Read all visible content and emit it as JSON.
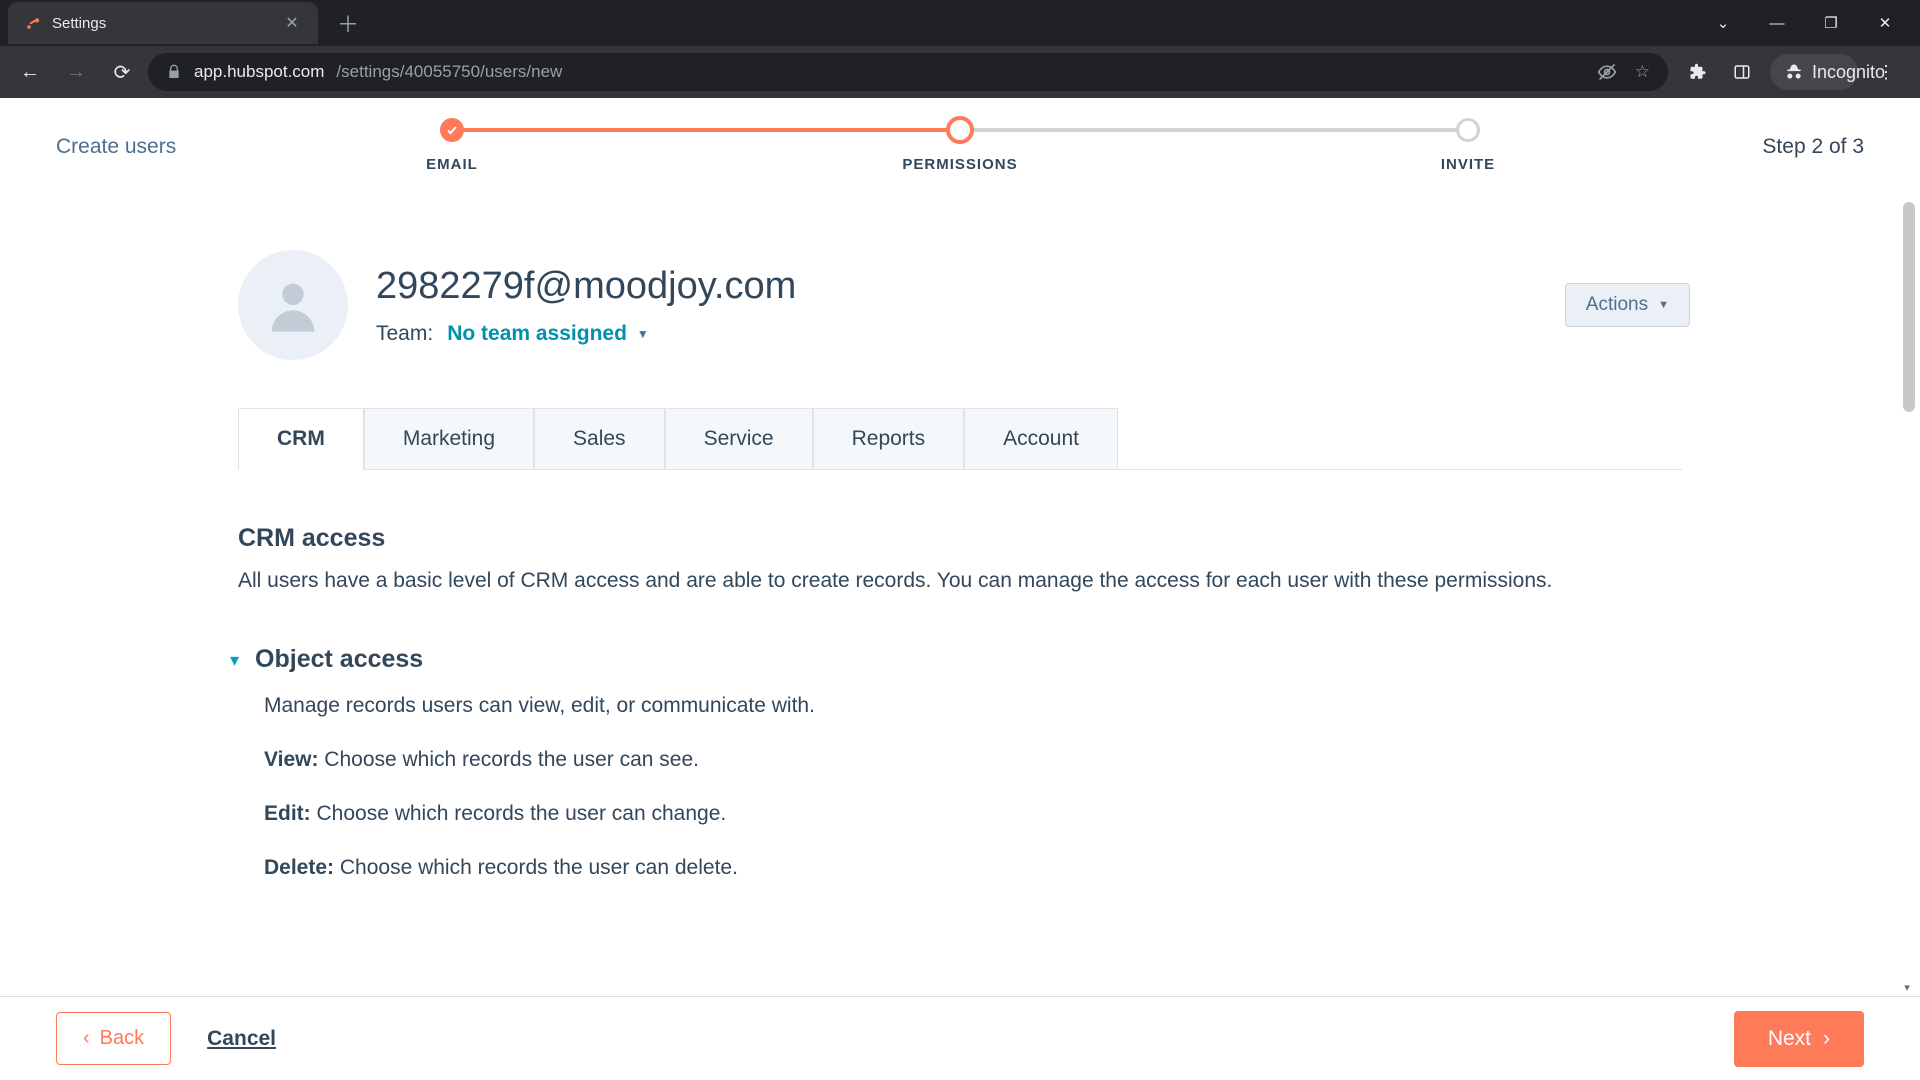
{
  "browser": {
    "tab_title": "Settings",
    "url_host": "app.hubspot.com",
    "url_path": "/settings/40055750/users/new",
    "incognito_label": "Incognito"
  },
  "header": {
    "create_users": "Create users",
    "step_text": "Step 2 of 3"
  },
  "stepper": {
    "steps": [
      {
        "label": "EMAIL"
      },
      {
        "label": "PERMISSIONS"
      },
      {
        "label": "INVITE"
      }
    ]
  },
  "user": {
    "email": "2982279f@moodjoy.com",
    "team_label": "Team:",
    "team_value": "No team assigned",
    "actions_label": "Actions"
  },
  "tabs": [
    {
      "label": "CRM"
    },
    {
      "label": "Marketing"
    },
    {
      "label": "Sales"
    },
    {
      "label": "Service"
    },
    {
      "label": "Reports"
    },
    {
      "label": "Account"
    }
  ],
  "crm_section": {
    "title": "CRM access",
    "desc": "All users have a basic level of CRM access and are able to create records. You can manage the access for each user with these permissions."
  },
  "object_access": {
    "title": "Object access",
    "desc": "Manage records users can view, edit, or communicate with.",
    "view_label": "View:",
    "view_text": " Choose which records the user can see.",
    "edit_label": "Edit:",
    "edit_text": " Choose which records the user can change.",
    "delete_label": "Delete:",
    "delete_text": " Choose which records the user can delete."
  },
  "footer": {
    "back": "Back",
    "cancel": "Cancel",
    "next": "Next"
  }
}
